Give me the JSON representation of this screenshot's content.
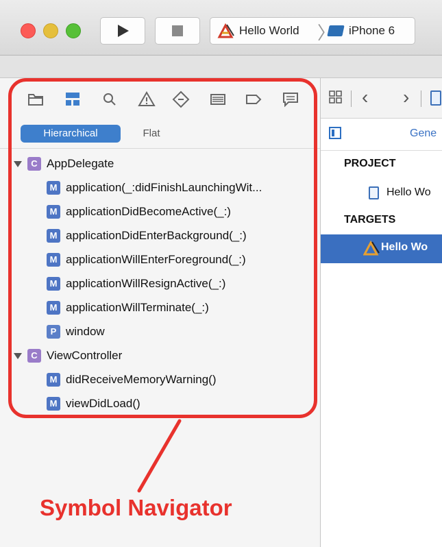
{
  "toolbar": {
    "scheme_project": "Hello World",
    "scheme_separator": "〉",
    "scheme_device": "iPhone 6"
  },
  "navigator": {
    "filter_tabs": [
      "Hierarchical",
      "Flat"
    ],
    "tree": [
      {
        "kind": "C",
        "label": "AppDelegate",
        "children": [
          {
            "kind": "M",
            "label": "application(_:didFinishLaunchingWit..."
          },
          {
            "kind": "M",
            "label": "applicationDidBecomeActive(_:)"
          },
          {
            "kind": "M",
            "label": "applicationDidEnterBackground(_:)"
          },
          {
            "kind": "M",
            "label": "applicationWillEnterForeground(_:)"
          },
          {
            "kind": "M",
            "label": "applicationWillResignActive(_:)"
          },
          {
            "kind": "M",
            "label": "applicationWillTerminate(_:)"
          },
          {
            "kind": "P",
            "label": "window"
          }
        ]
      },
      {
        "kind": "C",
        "label": "ViewController",
        "children": [
          {
            "kind": "M",
            "label": "didReceiveMemoryWarning()"
          },
          {
            "kind": "M",
            "label": "viewDidLoad()"
          }
        ]
      }
    ]
  },
  "callout": {
    "text": "Symbol Navigator"
  },
  "editor": {
    "general_tab": "Gene",
    "project_header": "PROJECT",
    "project_item": "Hello Wo",
    "targets_header": "TARGETS",
    "target_item": "Hello Wo"
  },
  "colors": {
    "accent": "#3e7fcc",
    "highlight": "#e8322d",
    "selection": "#3a6fc0"
  }
}
